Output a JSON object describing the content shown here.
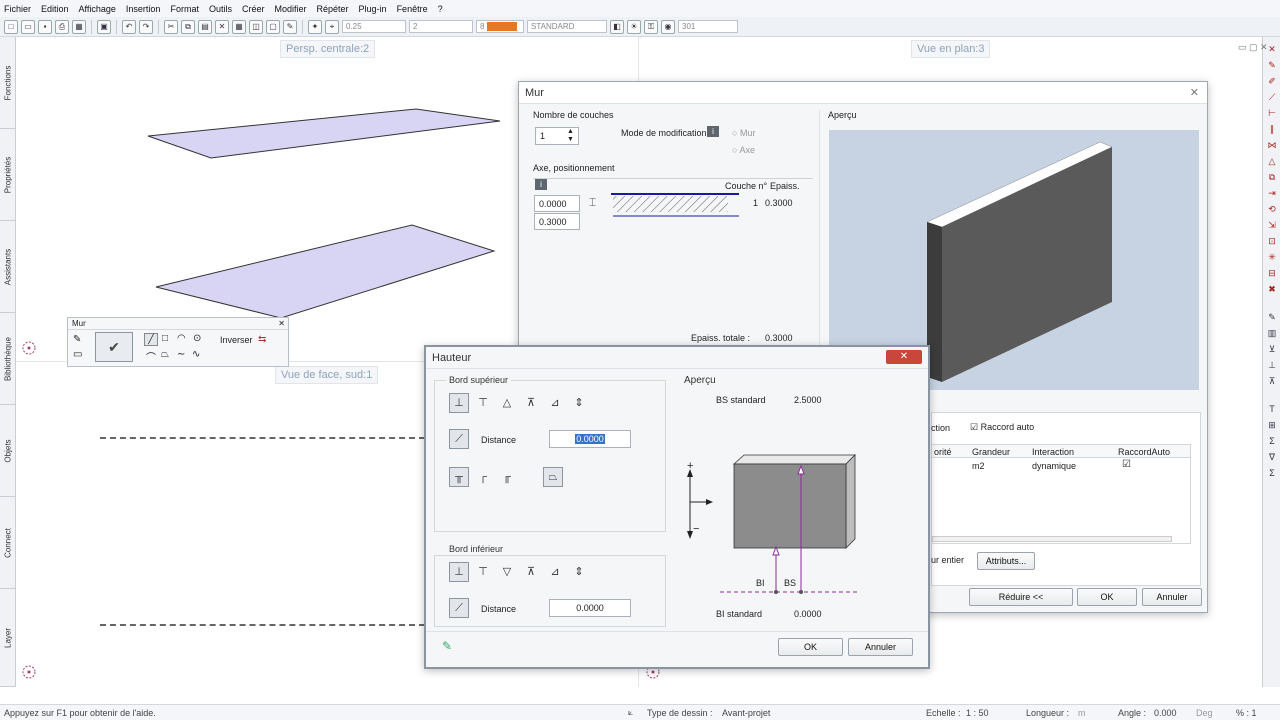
{
  "menu": [
    "Fichier",
    "Edition",
    "Affichage",
    "Insertion",
    "Format",
    "Outils",
    "Créer",
    "Modifier",
    "Répéter",
    "Plug-in",
    "Fenêtre",
    "?"
  ],
  "toolbar": {
    "pen": "0.25",
    "line": "2",
    "color_num": "8",
    "layer": "STANDARD",
    "hatch": "301"
  },
  "left_tabs": [
    "Fonctions",
    "Propriétés",
    "Assistants",
    "Bibliothèque",
    "Objets",
    "Connect",
    "Layer"
  ],
  "viewports": {
    "persp": "Persp. centrale:2",
    "plan": "Vue en plan:3",
    "face": "Vue de face, sud:1"
  },
  "mur_palette": {
    "title": "Mur",
    "inverser": "Inverser"
  },
  "mur_dialog": {
    "title": "Mur",
    "nombre_couches_label": "Nombre de couches",
    "nombre_couches_value": "1",
    "mode_label": "Mode de modification",
    "mode_opt1": "Mur",
    "mode_opt2": "Axe",
    "axe_label": "Axe, positionnement",
    "couche_header": "Couche n°",
    "epaiss_header": "Epaiss.",
    "couche_num": "1",
    "couche_ep": "0.3000",
    "field1": "0.0000",
    "field2": "0.3000",
    "total_label": "Epaiss. totale :",
    "total_value": "0.3000",
    "apercu": "Aperçu",
    "partial_label": "ction",
    "raccord_auto": "Raccord auto",
    "table_headers": [
      "orité",
      "Grandeur",
      "Interaction",
      "RaccordAuto"
    ],
    "table_row": [
      "",
      "m2",
      "dynamique",
      ""
    ],
    "mur_entier_label": "ur entier",
    "attributs": "Attributs...",
    "reduire": "Réduire <<",
    "ok": "OK",
    "annuler": "Annuler"
  },
  "hauteur_dialog": {
    "title": "Hauteur",
    "bord_sup": "Bord supérieur",
    "bord_inf": "Bord inférieur",
    "distance_label": "Distance",
    "distance_sup": "0.0000",
    "distance_inf": "0.0000",
    "apercu": "Aperçu",
    "bs_standard_label": "BS standard",
    "bs_standard_value": "2.5000",
    "bi_standard_label": "BI standard",
    "bi_standard_value": "0.0000",
    "bi": "BI",
    "bs": "BS",
    "plus": "+",
    "minus": "−",
    "ok": "OK",
    "annuler": "Annuler"
  },
  "status": {
    "help": "Appuyez sur F1 pour obtenir de l'aide.",
    "type_label": "Type de dessin :",
    "type_value": "Avant-projet",
    "echelle_label": "Echelle :",
    "echelle_value": "1 : 50",
    "longueur_label": "Longueur :",
    "longueur_unit": "m",
    "angle_label": "Angle :",
    "angle_value": "0.000",
    "angle_unit": "Deg",
    "pct": "% : 1"
  },
  "colors": {
    "accent": "#e87722",
    "preview_bg": "#c7d3e3",
    "wall_fill": "#5a5a5a",
    "slab_fill": "#d8d4f4",
    "purple": "#8a2a9a"
  }
}
